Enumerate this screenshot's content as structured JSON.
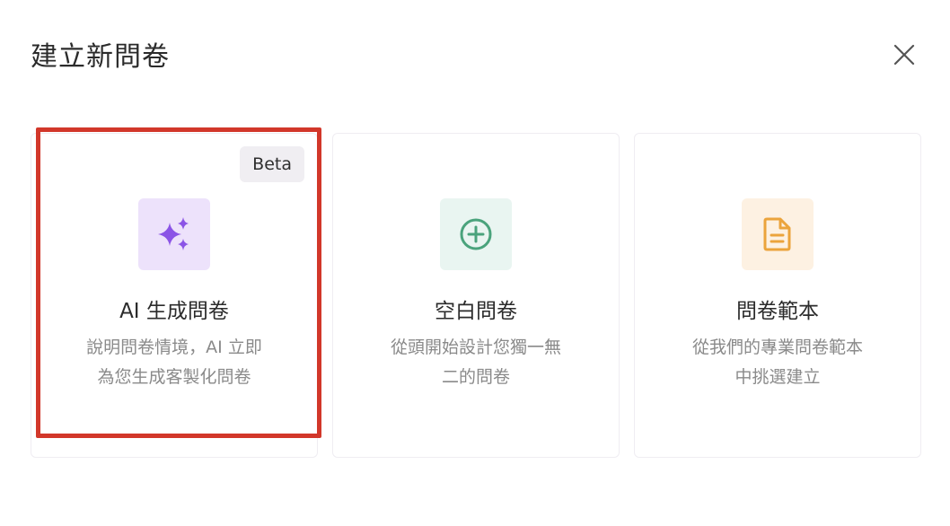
{
  "dialog": {
    "title": "建立新問卷",
    "close_icon": "close-icon"
  },
  "cards": [
    {
      "badge": "Beta",
      "icon": "sparkles-icon",
      "icon_color": "#8b54e6",
      "icon_bg": "#ede2fb",
      "title": "AI 生成問卷",
      "desc_line1": "說明問卷情境，AI 立即",
      "desc_line2": "為您生成客製化問卷",
      "selected": true
    },
    {
      "icon": "plus-circle-icon",
      "icon_color": "#4aa37c",
      "icon_bg": "#e9f5f1",
      "title": "空白問卷",
      "desc_line1": "從頭開始設計您獨一無",
      "desc_line2": "二的問卷"
    },
    {
      "icon": "document-icon",
      "icon_color": "#eba43c",
      "icon_bg": "#fdf1e2",
      "title": "問卷範本",
      "desc_line1": "從我們的專業問卷範本",
      "desc_line2": "中挑選建立"
    }
  ],
  "colors": {
    "highlight": "#d2372a"
  }
}
